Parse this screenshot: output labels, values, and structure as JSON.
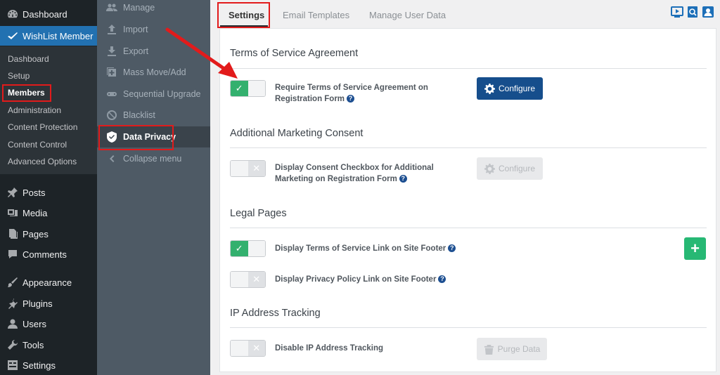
{
  "wp_menu": {
    "dashboard": "Dashboard",
    "wishlist_member": "WishList Member",
    "submenu": [
      "Dashboard",
      "Setup",
      "Members",
      "Administration",
      "Content Protection",
      "Content Control",
      "Advanced Options"
    ],
    "posts": "Posts",
    "media": "Media",
    "pages": "Pages",
    "comments": "Comments",
    "appearance": "Appearance",
    "plugins": "Plugins",
    "users": "Users",
    "tools": "Tools",
    "settings": "Settings"
  },
  "wlm_nav": {
    "manage": "Manage",
    "import": "Import",
    "export": "Export",
    "mass_move": "Mass Move/Add",
    "sequential": "Sequential Upgrade",
    "blacklist": "Blacklist",
    "data_privacy": "Data Privacy",
    "collapse": "Collapse menu"
  },
  "tabs": [
    "Settings",
    "Email Templates",
    "Manage User Data"
  ],
  "sections": {
    "tos": {
      "title": "Terms of Service Agreement",
      "label": "Require Terms of Service Agreement on Registration Form",
      "button": "Configure",
      "enabled": true
    },
    "marketing": {
      "title": "Additional Marketing Consent",
      "label": "Display Consent Checkbox for Additional Marketing on Registration Form",
      "button": "Configure",
      "enabled": false
    },
    "legal": {
      "title": "Legal Pages",
      "tos_link_label": "Display Terms of Service Link on Site Footer",
      "tos_link_enabled": true,
      "privacy_label": "Display Privacy Policy Link on Site Footer",
      "privacy_enabled": false,
      "add_symbol": "+"
    },
    "ip": {
      "title": "IP Address Tracking",
      "label": "Disable IP Address Tracking",
      "button": "Purge Data",
      "enabled": false
    }
  },
  "help_symbol": "?",
  "toggle_check": "✓",
  "toggle_x": "✕",
  "colors": {
    "wp_dark": "#1d2327",
    "wp_accent": "#2271b1",
    "wlm_nav_bg": "#4e5a65",
    "toggle_on": "#33b06e",
    "primary_button": "#164e8c",
    "add_button": "#27b874",
    "annotation_red": "#e21b1b"
  }
}
